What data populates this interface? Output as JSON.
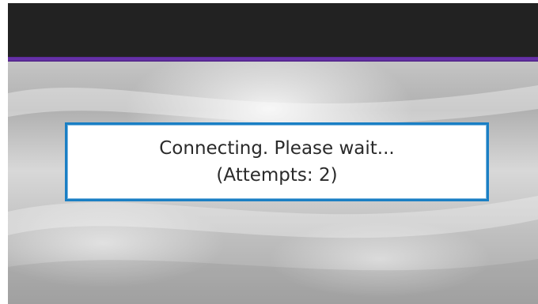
{
  "dialog": {
    "line1": "Connecting. Please wait...",
    "line2": "(Attempts: 2)",
    "attempts": 2
  },
  "colors": {
    "top_bar": "#222222",
    "accent": "#6b34b0",
    "dialog_border": "#1a7fc4",
    "background": "#c0c0c0",
    "text": "#2a2a2a"
  }
}
